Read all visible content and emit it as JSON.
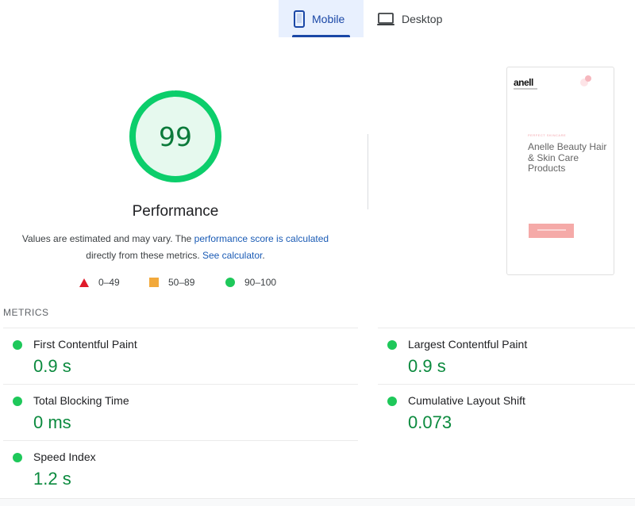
{
  "tabs": [
    {
      "label": "Mobile",
      "icon": "smartphone-icon",
      "active": true
    },
    {
      "label": "Desktop",
      "icon": "laptop-icon",
      "active": false
    }
  ],
  "score": {
    "value": "99",
    "title": "Performance",
    "color": "#0cce6b",
    "fill": 0.99
  },
  "description": {
    "text_before": "Values are estimated and may vary. The ",
    "link_score": "performance score is calculated",
    "text_middle": "directly from these metrics. ",
    "link_calc": "See calculator",
    "text_after": "."
  },
  "legend": [
    {
      "range": "0–49",
      "shape": "triangle",
      "color": "#e01b2a"
    },
    {
      "range": "50–89",
      "shape": "square",
      "color": "#f2a93b"
    },
    {
      "range": "90–100",
      "shape": "circle",
      "color": "#1ec85a"
    }
  ],
  "thumbnail": {
    "logo": "anell",
    "kicker": "PERFECT SKINCARE",
    "title": "Anelle Beauty Hair & Skin Care Products"
  },
  "metrics_label": "METRICS",
  "metrics": [
    {
      "name": "First Contentful Paint",
      "value": "0.9 s"
    },
    {
      "name": "Largest Contentful Paint",
      "value": "0.9 s"
    },
    {
      "name": "Total Blocking Time",
      "value": "0 ms"
    },
    {
      "name": "Cumulative Layout Shift",
      "value": "0.073"
    },
    {
      "name": "Speed Index",
      "value": "1.2 s"
    }
  ]
}
